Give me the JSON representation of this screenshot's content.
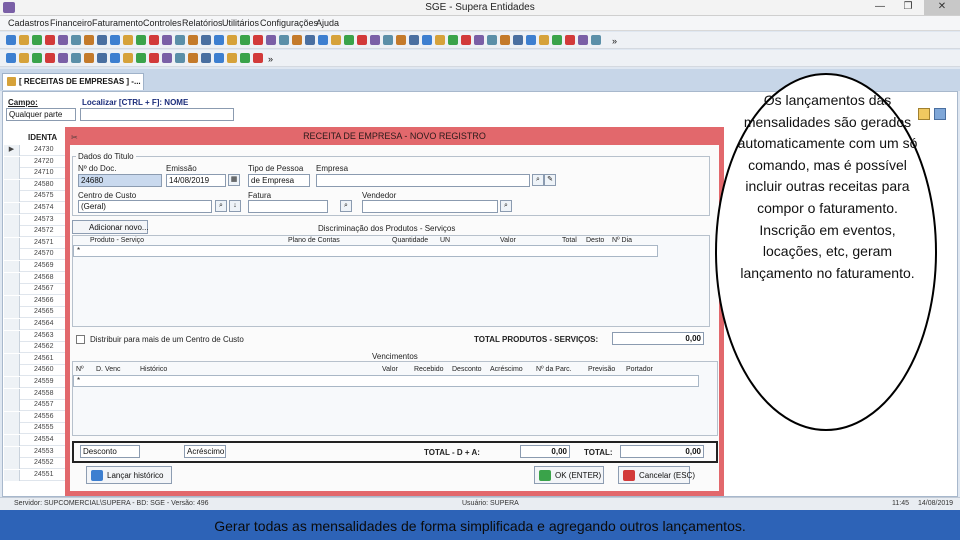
{
  "window": {
    "title": "SGE - Supera Entidades",
    "min_glyph": "—",
    "max_glyph": "❐",
    "close_glyph": "✕"
  },
  "menu": [
    "Cadastros",
    "Financeiro",
    "Faturamento",
    "Controles",
    "Relatórios",
    "Utilitários",
    "Configurações",
    "Ajuda"
  ],
  "toolbar_more_glyph": "»",
  "tab": {
    "label": "[ RECEITAS DE EMPRESAS ] -..."
  },
  "filter": {
    "campo_label": "Campo:",
    "campo_value": "Qualquer parte",
    "localizar_label": "Localizar [CTRL + F]: NOME"
  },
  "grid": {
    "header": "IDENTA",
    "rows": [
      "24730",
      "24720",
      "24710",
      "24580",
      "24575",
      "24574",
      "24573",
      "24572",
      "24571",
      "24570",
      "24569",
      "24568",
      "24567",
      "24566",
      "24565",
      "24564",
      "24563",
      "24562",
      "24561",
      "24560",
      "24559",
      "24558",
      "24557",
      "24556",
      "24555",
      "24554",
      "24553",
      "24552",
      "24551"
    ]
  },
  "dialog": {
    "title": "RECEITA DE EMPRESA - NOVO REGISTRO",
    "dados_label": "Dados do Titulo",
    "nr_doc_label": "Nº do Doc.",
    "nr_doc_value": "24680",
    "emissao_label": "Emissão",
    "emissao_value": "14/08/2019",
    "tipo_pessoa_label": "Tipo de Pessoa",
    "tipo_pessoa_value": "de Empresa",
    "empresa_label": "Empresa",
    "centro_label": "Centro de Custo",
    "centro_value": "(Geral)",
    "fatura_label": "Fatura",
    "vendedor_label": "Vendedor",
    "adicionar_label": "Adicionar novo...",
    "discriminacao_label": "Discriminação dos Produtos - Serviços",
    "item_cols": [
      "Produto - Serviço",
      "Plano de Contas",
      "Quantidade",
      "UN",
      "Valor",
      "Total",
      "Desto",
      "Nº Dia"
    ],
    "distrib_label": "Distribuir para mais de um Centro de Custo",
    "total_label": "TOTAL PRODUTOS - SERVIÇOS:",
    "total_value": "0,00",
    "vencimentos_label": "Vencimentos",
    "venc_cols": [
      "Nº",
      "D. Venc",
      "Histórico",
      "Valor",
      "Recebido",
      "Desconto",
      "Acréscimo",
      "Nº da Parc.",
      "Previsão",
      "Portador"
    ],
    "desconto_label": "Desconto",
    "acrescimo_label": "Acréscimo",
    "total_dacr_label": "TOTAL - D + A:",
    "total_dacr_value": "0,00",
    "total2_label": "TOTAL:",
    "total2_value": "0,00",
    "lancar_label": "Lançar histórico",
    "ok_label": "OK (ENTER)",
    "cancelar_label": "Cancelar (ESC)"
  },
  "status": {
    "servidor": "Servidor: SUPCOMERCIAL\\SUPERA - BD: SGE - Versão: 496",
    "usuario": "Usuário: SUPERA",
    "time": "11:45",
    "date": "14/08/2019"
  },
  "callout": "Os lançamentos das mensalidades são gerados automaticamente com um só comando, mas é possível incluir outras receitas para compor o faturamento. Inscrição em eventos, locações, etc, geram lançamento no faturamento.",
  "caption": "Gerar todas as mensalidades de forma simplificada e agregando outros lançamentos.",
  "colors": {
    "dialog_border": "#e2686c",
    "caption_bar": "#2d63b7",
    "tab_strip": "#c7d6e8"
  }
}
